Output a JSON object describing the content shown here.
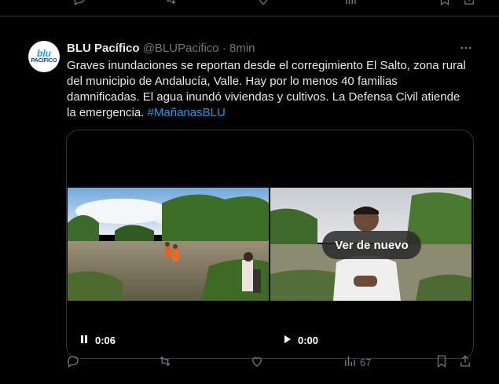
{
  "tweet": {
    "name": "BLU Pacífico",
    "handle": "@BLUPacifico",
    "separator": "·",
    "time": "8min",
    "text": "Graves inundaciones se reportan desde el corregimiento El Salto, zona rural del municipio de Andalucía, Valle. Hay por lo menos 40 familias damnificadas. El agua inundó viviendas y cultivos. La Defensa Civil atiende la emergencia.",
    "hashtag": "#MañanasBLU",
    "avatar_top": "blu",
    "avatar_bottom": "PACÍFICO"
  },
  "media": {
    "replay_label": "Ver de nuevo",
    "left_time": "0:06",
    "right_time": "0:00"
  },
  "actions": {
    "views": "67"
  },
  "colors": {
    "background": "#000000",
    "text": "#e7e9ea",
    "muted": "#71767b",
    "link": "#1d9bf0",
    "border": "#2f3336"
  }
}
